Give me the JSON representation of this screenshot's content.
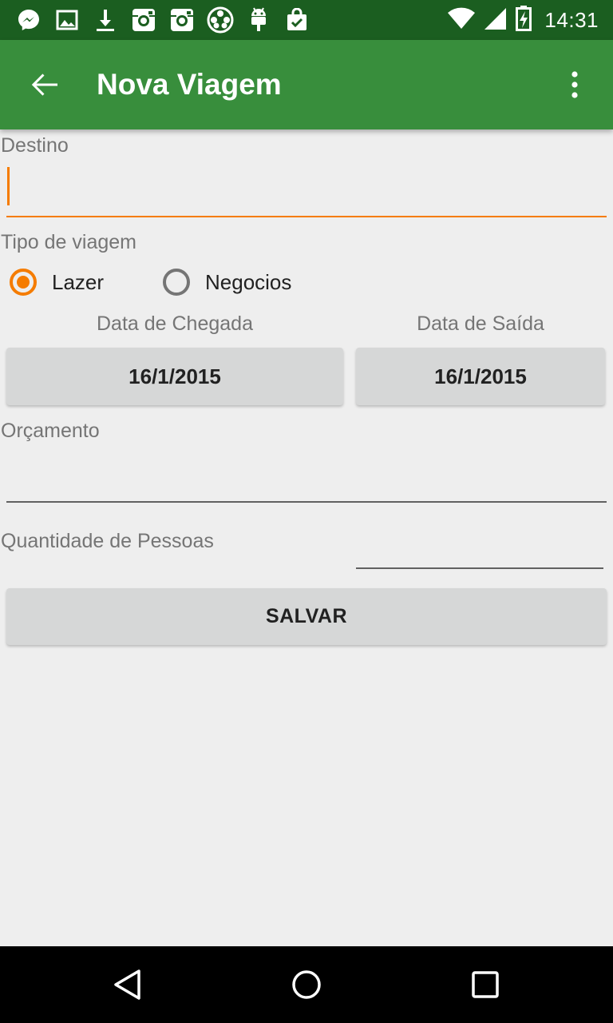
{
  "status_bar": {
    "time": "14:31",
    "left_icons": [
      "messenger-icon",
      "image-icon",
      "download-icon",
      "instagram-icon",
      "instagram-icon",
      "film-reel-icon",
      "android-icon",
      "shopping-bag-icon"
    ],
    "right_icons": [
      "wifi-icon",
      "signal-icon",
      "battery-charging-icon"
    ]
  },
  "app_bar": {
    "title": "Nova Viagem",
    "background": "#388e3c",
    "status_background": "#1b5e20"
  },
  "form": {
    "destino_label": "Destino",
    "destino_value": "",
    "tipo_label": "Tipo de viagem",
    "tipo_options": [
      {
        "label": "Lazer",
        "checked": true
      },
      {
        "label": "Negocios",
        "checked": false
      }
    ],
    "data_chegada_label": "Data de Chegada",
    "data_chegada_value": "16/1/2015",
    "data_saida_label": "Data de Saída",
    "data_saida_value": "16/1/2015",
    "orcamento_label": "Orçamento",
    "orcamento_value": "",
    "quantidade_label": "Quantidade de Pessoas",
    "quantidade_value": "",
    "save_label": "SALVAR",
    "accent": "#f57c00"
  },
  "nav_bar": {
    "icons": [
      "back-triangle-icon",
      "home-circle-icon",
      "recents-square-icon"
    ]
  }
}
